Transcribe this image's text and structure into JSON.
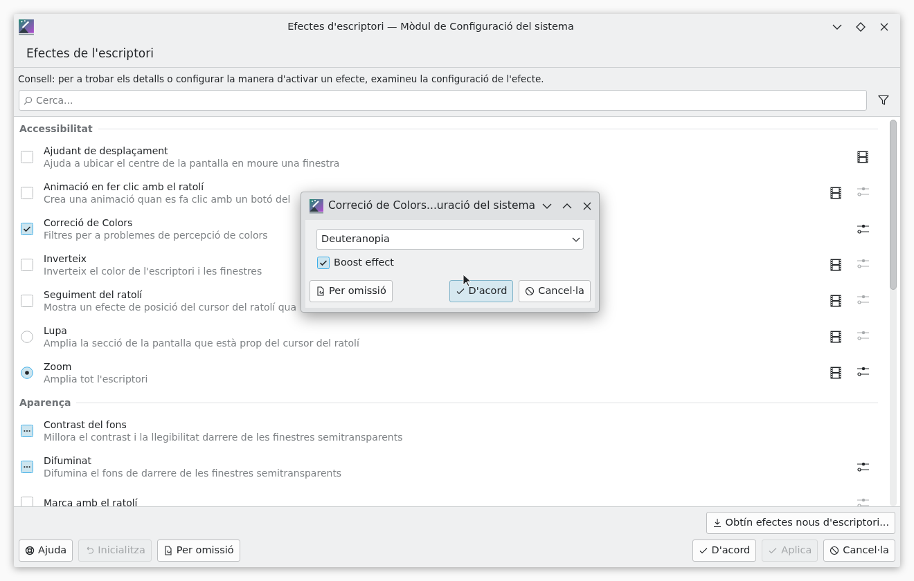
{
  "window": {
    "title": "Efectes d'escriptori — Mòdul de Configuració del sistema"
  },
  "page_title": "Efectes de l'escriptori",
  "hint": "Consell: per a trobar els detalls o configurar la manera d'activar un efecte, examineu la configuració de l'efecte.",
  "search": {
    "placeholder": "Cerca..."
  },
  "sections": [
    {
      "title": "Accessibilitat",
      "effects": [
        {
          "name": "Ajudant de desplaçament",
          "description": "Ajuda a ubicar el centre de la pantalla en moure una finestra",
          "kind": "checkbox",
          "checked": false,
          "video": true
        },
        {
          "name": "Animació en fer clic amb el ratolí",
          "description": "Crea una animació quan es fa clic amb un botó del",
          "kind": "checkbox",
          "checked": false,
          "video": true,
          "settings_enabled": false
        },
        {
          "name": "Correció de Colors",
          "description": "Filtres per a problemes de percepció de colors",
          "kind": "checkbox",
          "checked": true,
          "video": false,
          "settings_enabled": true
        },
        {
          "name": "Inverteix",
          "description": "Inverteix el color de l'escriptori i les finestres",
          "kind": "checkbox",
          "checked": false,
          "video": true,
          "settings_enabled": false
        },
        {
          "name": "Seguiment del ratolí",
          "description": "Mostra un efecte de posició del cursor del ratolí qua",
          "kind": "checkbox",
          "checked": false,
          "video": true,
          "settings_enabled": false
        },
        {
          "name": "Lupa",
          "description": "Amplia la secció de la pantalla que està prop del cursor del ratolí",
          "kind": "radio",
          "checked": false,
          "video": true,
          "settings_enabled": false
        },
        {
          "name": "Zoom",
          "description": "Amplia tot l'escriptori",
          "kind": "radio",
          "checked": true,
          "video": true,
          "settings_enabled": true
        }
      ]
    },
    {
      "title": "Aparença",
      "effects": [
        {
          "name": "Contrast del fons",
          "description": "Millora el contrast i la llegibilitat darrere de les finestres semitransparents",
          "kind": "mixed",
          "checked": true,
          "video": false
        },
        {
          "name": "Difuminat",
          "description": "Difumina el fons de darrere de les finestres semitransparents",
          "kind": "mixed",
          "checked": true,
          "video": false,
          "settings_enabled": true
        },
        {
          "name": "Marca amb el ratolí",
          "kind": "checkbox",
          "checked": false,
          "video": false,
          "settings_enabled": false
        }
      ]
    }
  ],
  "get_new_button": "Obtín efectes nous d'escriptori...",
  "footer_left": [
    {
      "label": "Ajuda",
      "disabled": false
    },
    {
      "label": "Inicialitza",
      "disabled": true
    },
    {
      "label": "Per omissió",
      "disabled": false
    }
  ],
  "footer_right": [
    {
      "label": "D'acord",
      "disabled": false
    },
    {
      "label": "Aplica",
      "disabled": true
    },
    {
      "label": "Cancel·la",
      "disabled": false
    }
  ],
  "dialog": {
    "title": "Correció de Colors...uració del sistema",
    "select_value": "Deuteranopia",
    "checkbox": {
      "label": "Boost effect",
      "checked": true
    },
    "buttons": [
      {
        "label": "Per omissió",
        "focused": false
      },
      {
        "label": "D'acord",
        "focused": true
      },
      {
        "label": "Cancel·la",
        "focused": false
      }
    ]
  }
}
